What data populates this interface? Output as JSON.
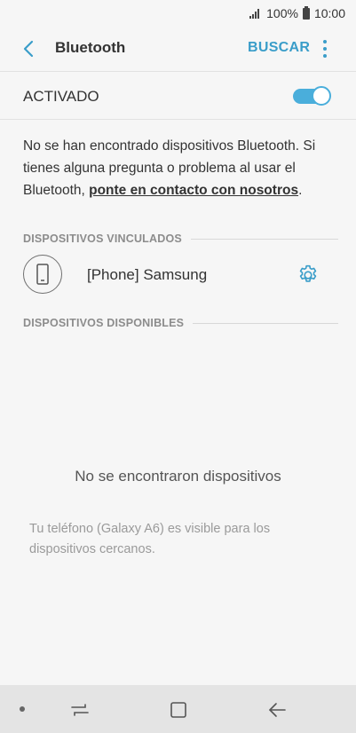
{
  "status_bar": {
    "battery": "100%",
    "time": "10:00"
  },
  "app_bar": {
    "title": "Bluetooth",
    "search_label": "BUSCAR"
  },
  "toggle": {
    "label": "ACTIVADO",
    "state": "on"
  },
  "info": {
    "text_before": "No se han encontrado dispositivos Bluetooth. Si tienes alguna pregunta o problema al usar el Bluetooth, ",
    "link_text": "ponte en contacto con nosotros",
    "text_after": "."
  },
  "paired": {
    "heading": "DISPOSITIVOS VINCULADOS",
    "device_name": "[Phone] Samsung"
  },
  "available": {
    "heading": "DISPOSITIVOS DISPONIBLES",
    "empty_text": "No se encontraron dispositivos"
  },
  "visibility": {
    "text": "Tu teléfono (Galaxy A6) es visible para los dispositivos cercanos."
  },
  "colors": {
    "accent": "#3a9dc9",
    "switch_on": "#4aaedb"
  },
  "icons": {
    "back": "chevron-left-icon",
    "more": "more-vert-icon",
    "device": "phone-icon",
    "settings": "gear-icon",
    "nav_recents": "recents-icon",
    "nav_home": "home-icon",
    "nav_back": "back-arrow-icon"
  }
}
